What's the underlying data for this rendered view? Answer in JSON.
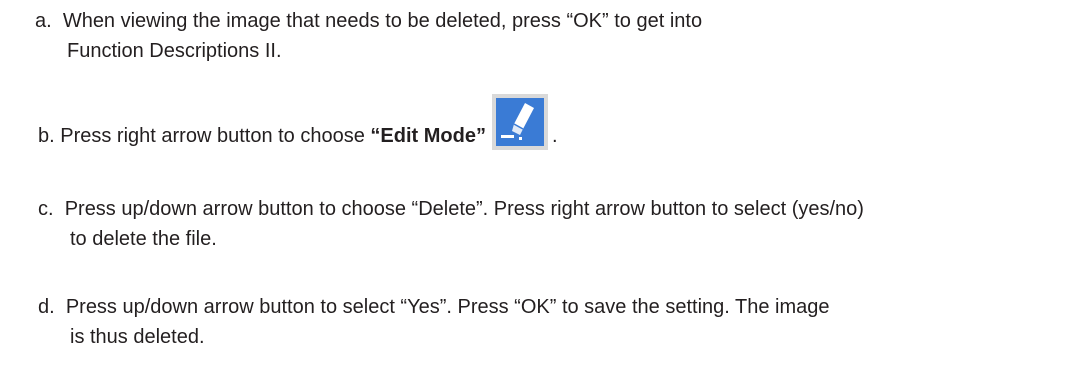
{
  "steps": [
    {
      "id": "a",
      "prefix": "a.",
      "line1": "When viewing the image that needs to be deleted, press “OK” to get into",
      "line2": "Function Descriptions II."
    },
    {
      "id": "b",
      "prefix": "b.",
      "text_before": "Press right arrow button to choose",
      "bold_text": "“Edit Mode”",
      "icon": "edit-mode-icon",
      "text_after": "."
    },
    {
      "id": "c",
      "prefix": "c.",
      "line1": "Press up/down arrow button to choose “Delete”.  Press right arrow button to select (yes/no)",
      "line2": "to delete the file."
    },
    {
      "id": "d",
      "prefix": "d.",
      "line1": "Press up/down arrow button to select “Yes”.  Press “OK”  to save the setting.  The image",
      "line2": "is thus deleted."
    }
  ],
  "colors": {
    "text": "#231f20",
    "icon_bg": "#3a7bd5",
    "icon_frame": "#d9d9d9"
  }
}
